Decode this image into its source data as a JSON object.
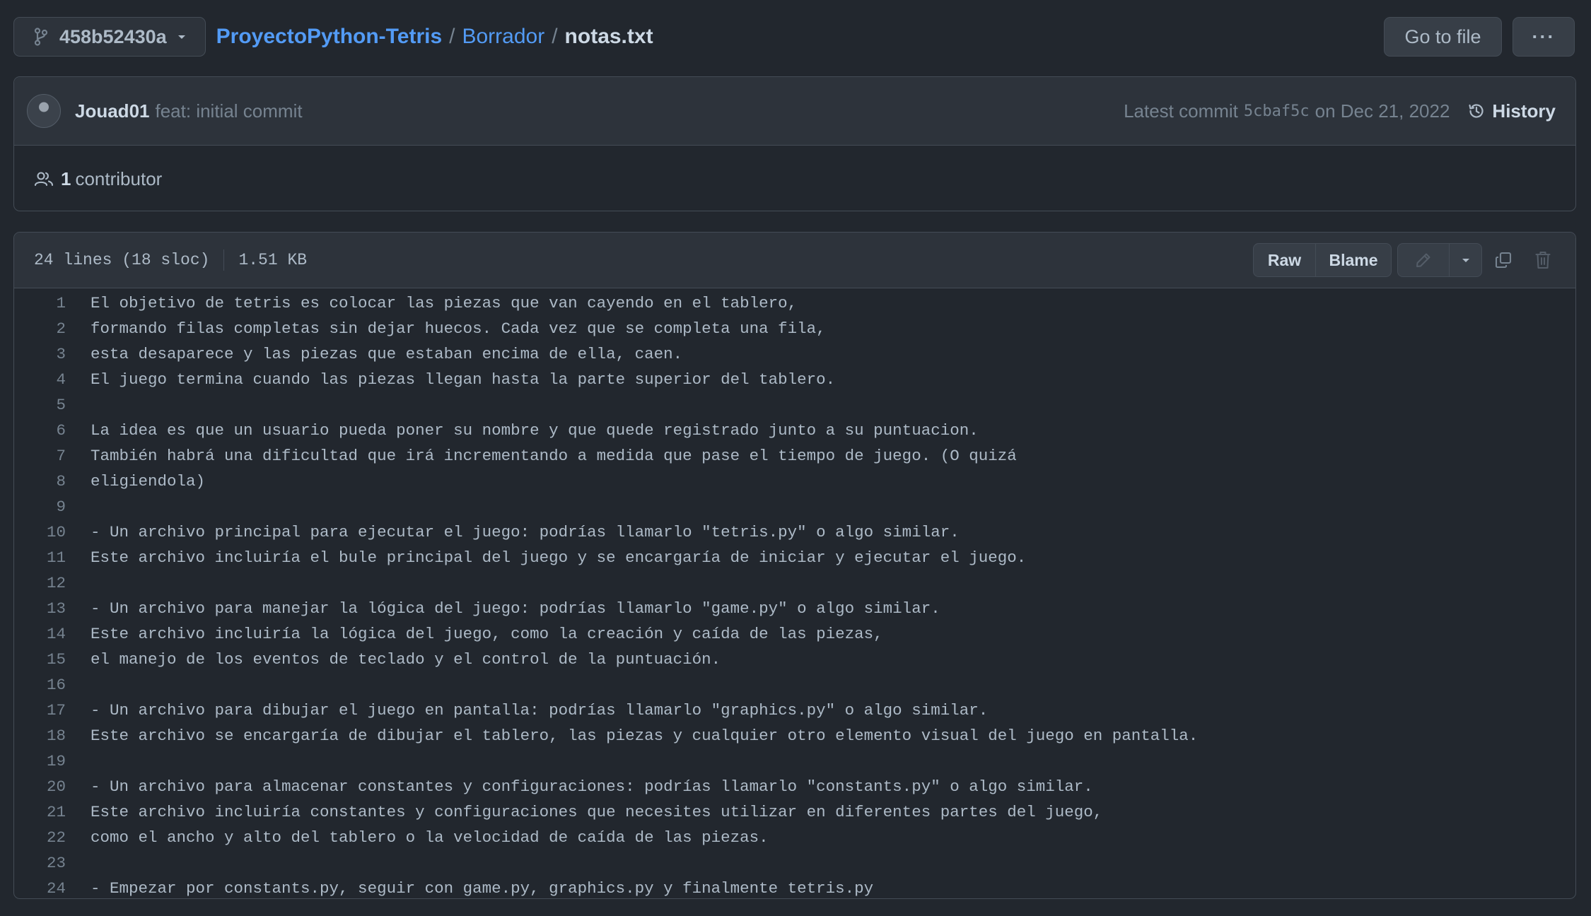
{
  "header": {
    "branch": "458b52430a",
    "repo": "ProyectoPython-Tetris",
    "folder": "Borrador",
    "file": "notas.txt",
    "sep1": "/",
    "sep2": "/",
    "go_to_file": "Go to file",
    "more": "···"
  },
  "commit": {
    "author": "Jouad01",
    "message": "feat: initial commit",
    "latest_label": "Latest commit",
    "sha": "5cbaf5c",
    "date": "on Dec 21, 2022",
    "history": "History"
  },
  "contributors": {
    "count": "1",
    "label": "contributor"
  },
  "file_header": {
    "lines": "24 lines (18 sloc)",
    "size": "1.51 KB",
    "raw": "Raw",
    "blame": "Blame"
  },
  "code_lines": [
    "El objetivo de tetris es colocar las piezas que van cayendo en el tablero,",
    "formando filas completas sin dejar huecos. Cada vez que se completa una fila,",
    "esta desaparece y las piezas que estaban encima de ella, caen.",
    "El juego termina cuando las piezas llegan hasta la parte superior del tablero.",
    "",
    "La idea es que un usuario pueda poner su nombre y que quede registrado junto a su puntuacion.",
    "También habrá una dificultad que irá incrementando a medida que pase el tiempo de juego. (O quizá",
    "eligiendola)",
    "",
    "- Un archivo principal para ejecutar el juego: podrías llamarlo \"tetris.py\" o algo similar.",
    "Este archivo incluiría el bule principal del juego y se encargaría de iniciar y ejecutar el juego.",
    "",
    "- Un archivo para manejar la lógica del juego: podrías llamarlo \"game.py\" o algo similar.",
    "Este archivo incluiría la lógica del juego, como la creación y caída de las piezas,",
    "el manejo de los eventos de teclado y el control de la puntuación.",
    "",
    "- Un archivo para dibujar el juego en pantalla: podrías llamarlo \"graphics.py\" o algo similar.",
    "Este archivo se encargaría de dibujar el tablero, las piezas y cualquier otro elemento visual del juego en pantalla.",
    "",
    "- Un archivo para almacenar constantes y configuraciones: podrías llamarlo \"constants.py\" o algo similar.",
    "Este archivo incluiría constantes y configuraciones que necesites utilizar en diferentes partes del juego,",
    "como el ancho y alto del tablero o la velocidad de caída de las piezas.",
    "",
    "- Empezar por constants.py, seguir con game.py, graphics.py y finalmente tetris.py"
  ],
  "icons": {
    "branch": "git-branch-icon",
    "caret": "triangle-down-icon",
    "history": "history-clock-icon",
    "people": "people-icon",
    "edit": "pencil-icon",
    "copy": "copy-icon",
    "delete": "trash-icon"
  },
  "colors": {
    "background": "#22272e",
    "panel": "#2d333b",
    "border": "#444c56",
    "link": "#539bf5",
    "text": "#adbac7",
    "muted": "#768390"
  }
}
